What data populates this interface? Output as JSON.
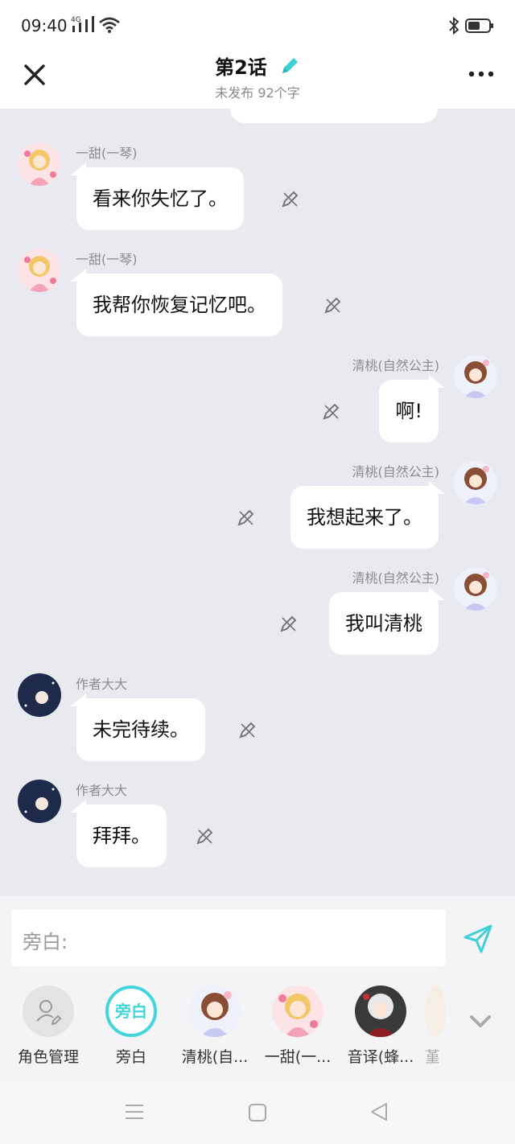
{
  "status_bar": {
    "time": "09:40",
    "network_badge": "4G",
    "icons": [
      "signal-icon",
      "wifi-icon",
      "bluetooth-icon",
      "battery-icon"
    ]
  },
  "header": {
    "title": "第2话",
    "subtitle": "未发布 92个字",
    "accent_color": "#3fd0d6"
  },
  "messages": [
    {
      "speaker": "一甜(一琴)",
      "text": "看来你失忆了。",
      "side": "left",
      "avatar": "yitian"
    },
    {
      "speaker": "一甜(一琴)",
      "text": "我帮你恢复记忆吧。",
      "side": "left",
      "avatar": "yitian"
    },
    {
      "speaker": "清桃(自然公主)",
      "text": "啊!",
      "side": "right",
      "avatar": "qingtao"
    },
    {
      "speaker": "清桃(自然公主)",
      "text": "我想起来了。",
      "side": "right",
      "avatar": "qingtao"
    },
    {
      "speaker": "清桃(自然公主)",
      "text": "我叫清桃",
      "side": "right",
      "avatar": "qingtao"
    },
    {
      "speaker": "作者大大",
      "text": "未完待续。",
      "side": "left",
      "avatar": "author"
    },
    {
      "speaker": "作者大大",
      "text": "拜拜。",
      "side": "left",
      "avatar": "author"
    }
  ],
  "input": {
    "placeholder": "旁白:"
  },
  "roles": [
    {
      "label": "角色管理",
      "type": "manage"
    },
    {
      "label": "旁白",
      "badge": "旁白",
      "type": "narration"
    },
    {
      "label": "清桃(自...",
      "type": "qingtao"
    },
    {
      "label": "一甜(一...",
      "type": "yitian"
    },
    {
      "label": "音译(蜂...",
      "type": "yinyi"
    },
    {
      "label": "堇",
      "type": "partial"
    }
  ],
  "nav_bar": {
    "icons": [
      "menu-icon",
      "home-icon",
      "back-icon"
    ]
  }
}
